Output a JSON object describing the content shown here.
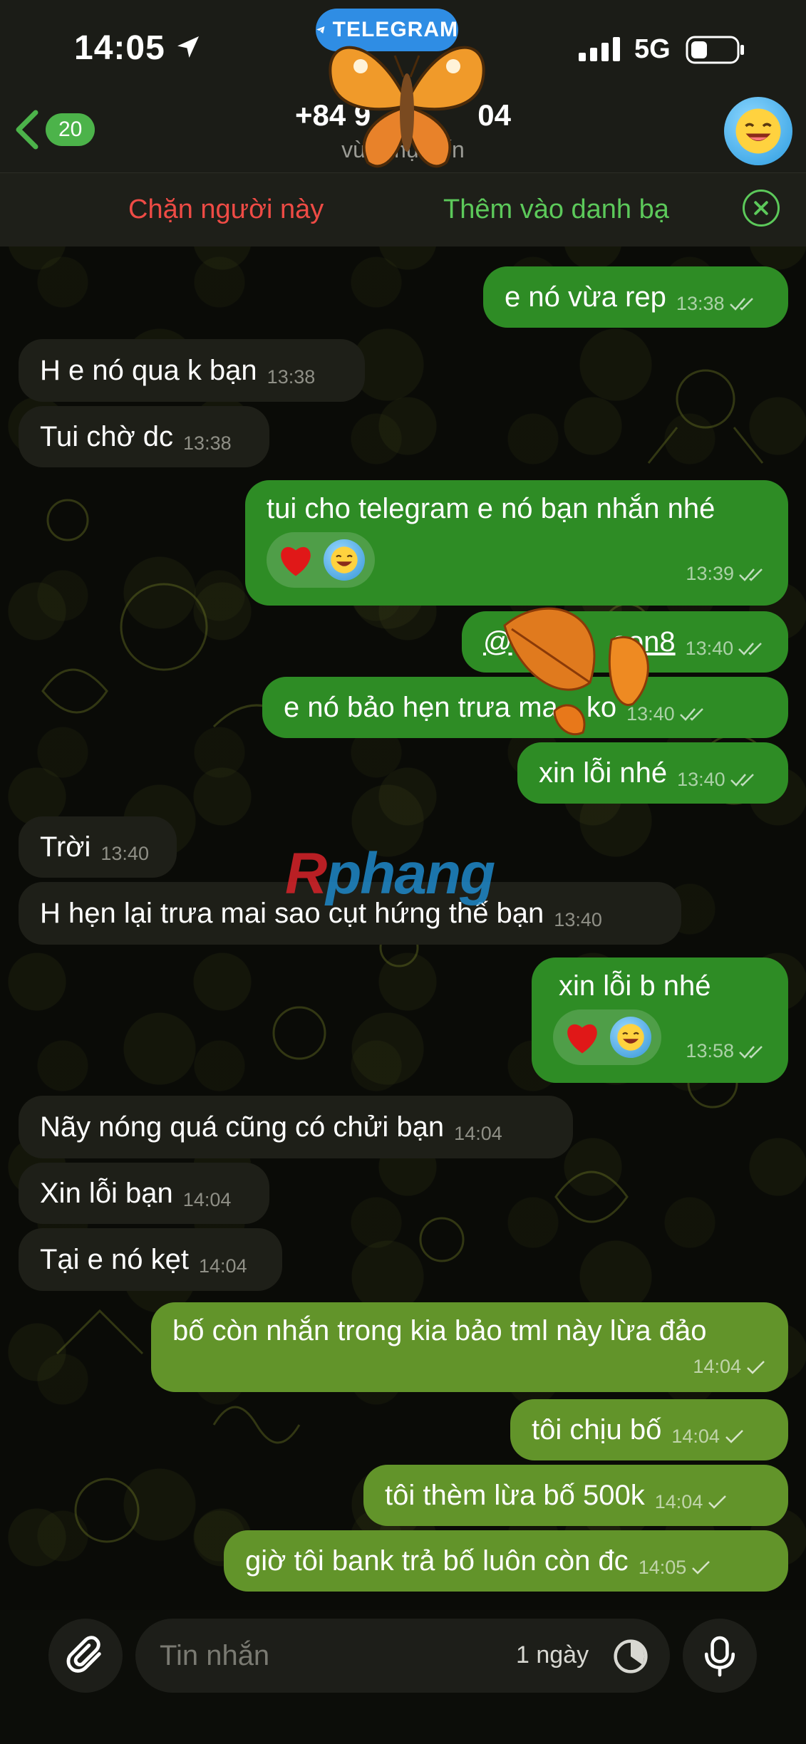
{
  "status_bar": {
    "time": "14:05",
    "telegram_label": "TELEGRAM",
    "network": "5G"
  },
  "nav": {
    "back_count": "20",
    "title": "+84 9",
    "title_suffix": "04",
    "status": "vừa m",
    "status_suffix": "ực   ến"
  },
  "actions": {
    "block": "Chặn người này",
    "add_contact": "Thêm vào danh bạ"
  },
  "messages": [
    {
      "dir": "out",
      "text": "e nó vừa rep",
      "time": "13:38",
      "read": true
    },
    {
      "dir": "in",
      "text": "H e nó qua k bạn",
      "time": "13:38"
    },
    {
      "dir": "in",
      "text": "Tui chờ dc",
      "time": "13:38"
    },
    {
      "dir": "out",
      "text": "tui cho telegram e nó bạn nhắn nhé",
      "time": "13:39",
      "read": true,
      "reactions": [
        "heart",
        "laugh"
      ]
    },
    {
      "dir": "out",
      "text": "@",
      "text_suffix": "oon8",
      "time": "13:40",
      "read": true
    },
    {
      "dir": "out",
      "text": "e nó bảo hẹn trưa ma",
      "text_suffix": "ko",
      "time": "13:40",
      "read": true
    },
    {
      "dir": "out",
      "text": "xin lỗi nhé",
      "time": "13:40",
      "read": true
    },
    {
      "dir": "in",
      "text": "Trời",
      "time": "13:40"
    },
    {
      "dir": "in",
      "text": "H hẹn lại trưa mai sao cụt hứng thế bạn",
      "time": "13:40"
    },
    {
      "dir": "out",
      "text": "xin lỗi b nhé",
      "time": "13:58",
      "read": true,
      "reactions": [
        "heart",
        "laugh"
      ]
    },
    {
      "dir": "in",
      "text": "Nãy nóng quá cũng có chửi bạn",
      "time": "14:04"
    },
    {
      "dir": "in",
      "text": "Xin lỗi bạn",
      "time": "14:04"
    },
    {
      "dir": "in",
      "text": "Tại e nó kẹt",
      "time": "14:04"
    },
    {
      "dir": "out2",
      "text": "bố còn nhắn trong kia bảo tml này lừa đảo",
      "time": "14:04",
      "read": false
    },
    {
      "dir": "out2",
      "text": "tôi chịu bố",
      "time": "14:04",
      "read": false
    },
    {
      "dir": "out2",
      "text": "tôi thèm lừa bố 500k",
      "time": "14:04",
      "read": false
    },
    {
      "dir": "out2",
      "text": "giờ tôi bank trả bố luôn còn đc",
      "time": "14:05",
      "read": false
    }
  ],
  "composer": {
    "placeholder": "Tin nhắn",
    "timer_label": "1 ngày"
  },
  "watermark": {
    "part1": "R",
    "part2": "phang"
  },
  "colors": {
    "outgoing_bubble": "#2e8c25",
    "outgoing_bubble_recent": "#62942a",
    "incoming_bubble": "#1e1f18",
    "accent_green": "#5cc95a",
    "block_red": "#ee4b45",
    "telegram_blue": "#2f8de4"
  }
}
